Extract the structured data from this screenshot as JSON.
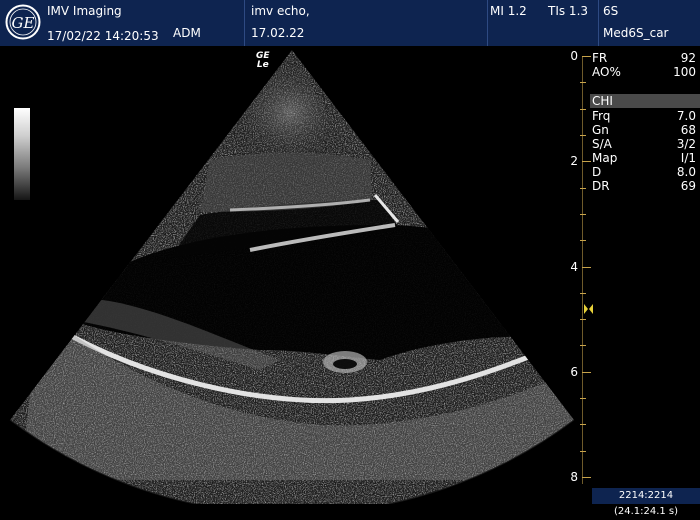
{
  "header": {
    "brand": "IMV Imaging",
    "datetime": "17/02/22 14:20:53",
    "operator": "ADM",
    "study_name": "imv echo,",
    "study_date": "17.02.22",
    "mi": "MI 1.2",
    "tis": "TIs 1.3",
    "probe": "6S",
    "preset": "Med6S_car"
  },
  "logo_text": "GE",
  "image_marker": {
    "top": "GE",
    "bottom": "Le"
  },
  "params_top": [
    {
      "k": "FR",
      "v": "92"
    },
    {
      "k": "AO%",
      "v": "100"
    }
  ],
  "mode": "CHI",
  "params": [
    {
      "k": "Frq",
      "v": "7.0"
    },
    {
      "k": "Gn",
      "v": "68"
    },
    {
      "k": "S/A",
      "v": "3/2"
    },
    {
      "k": "Map",
      "v": "I/1"
    },
    {
      "k": "D",
      "v": "8.0"
    },
    {
      "k": "DR",
      "v": "69"
    }
  ],
  "depth_scale": {
    "labels": [
      "0",
      "2",
      "4",
      "6",
      "8"
    ],
    "max_cm": 8
  },
  "focus_marker_depth_cm": 4.8,
  "footer": "2214:2214  (24.1:24.1 s)",
  "colors": {
    "header_bg": "#0e2450",
    "scale": "#c8a34a",
    "chi_bar": "#4a4a4a"
  }
}
